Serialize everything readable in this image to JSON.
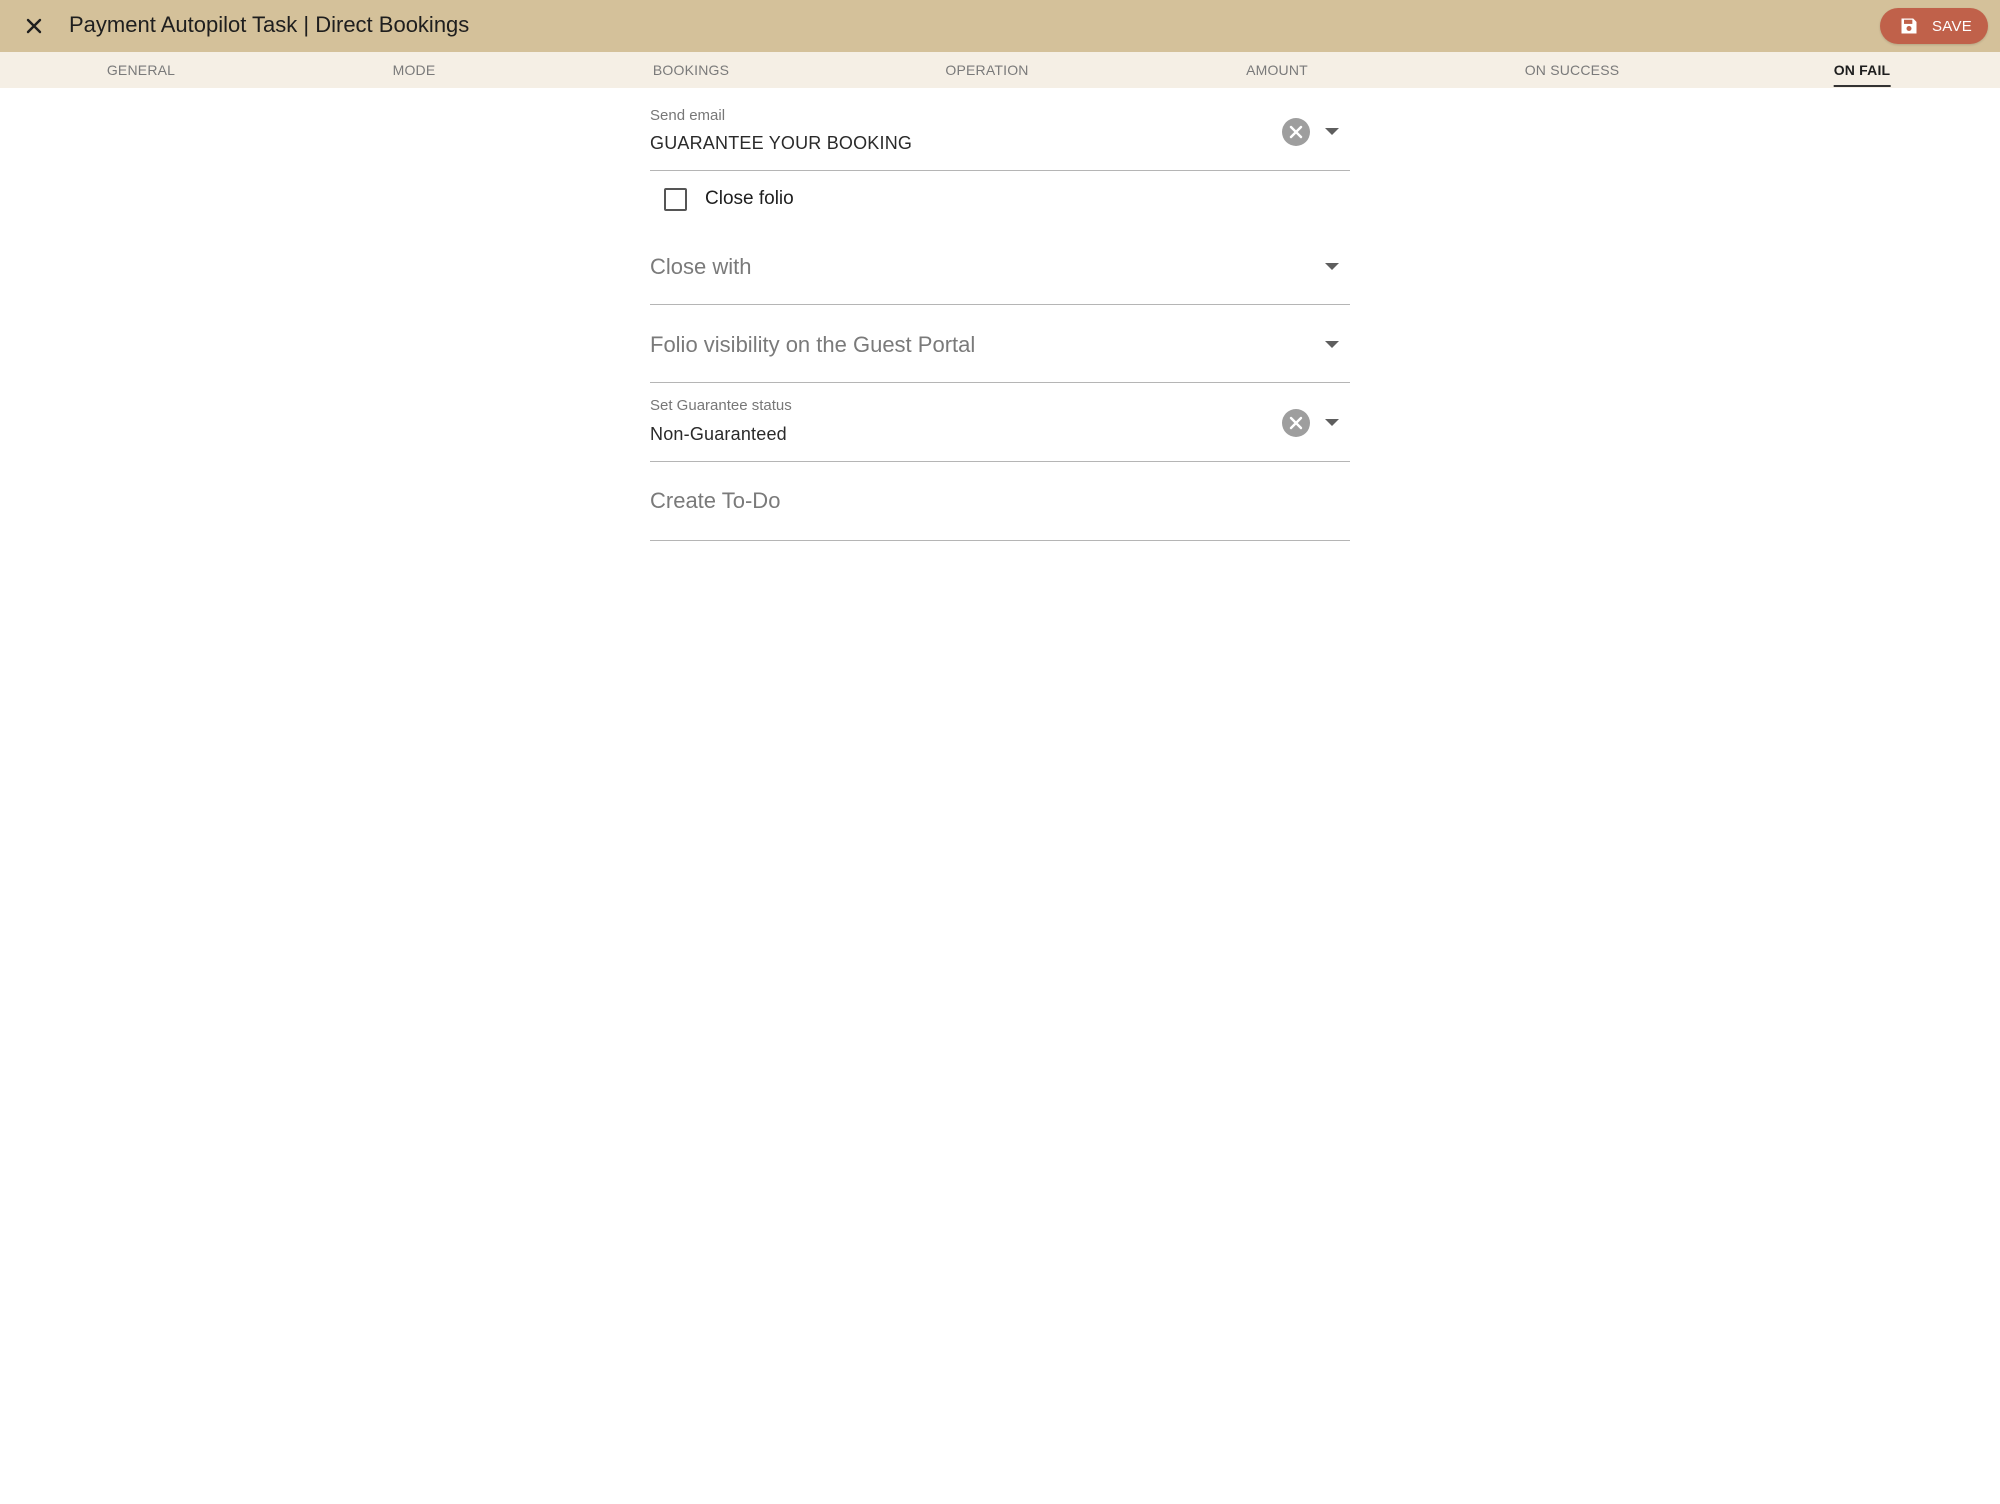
{
  "app_bar": {
    "title": "Payment Autopilot Task | Direct Bookings",
    "close_icon": "close-icon",
    "save_label": "SAVE",
    "save_icon": "floppy-disk-icon",
    "background_color": "#d4c19a",
    "save_color": "#c0614a"
  },
  "tabs": [
    {
      "label": "GENERAL",
      "active": false
    },
    {
      "label": "MODE",
      "active": false
    },
    {
      "label": "BOOKINGS",
      "active": false
    },
    {
      "label": "OPERATION",
      "active": false
    },
    {
      "label": "AMOUNT",
      "active": false
    },
    {
      "label": "ON SUCCESS",
      "active": false
    },
    {
      "label": "ON FAIL",
      "active": true
    }
  ],
  "form": {
    "send_email": {
      "label": "Send email",
      "value": "GUARANTEE YOUR BOOKING"
    },
    "close_folio": {
      "label": "Close folio",
      "checked": false
    },
    "close_with": {
      "placeholder": "Close with"
    },
    "folio_visibility": {
      "placeholder": "Folio visibility on the Guest Portal"
    },
    "guarantee_status": {
      "label": "Set Guarantee status",
      "value": "Non-Guaranteed"
    },
    "create_todo": {
      "placeholder": "Create To-Do"
    }
  }
}
